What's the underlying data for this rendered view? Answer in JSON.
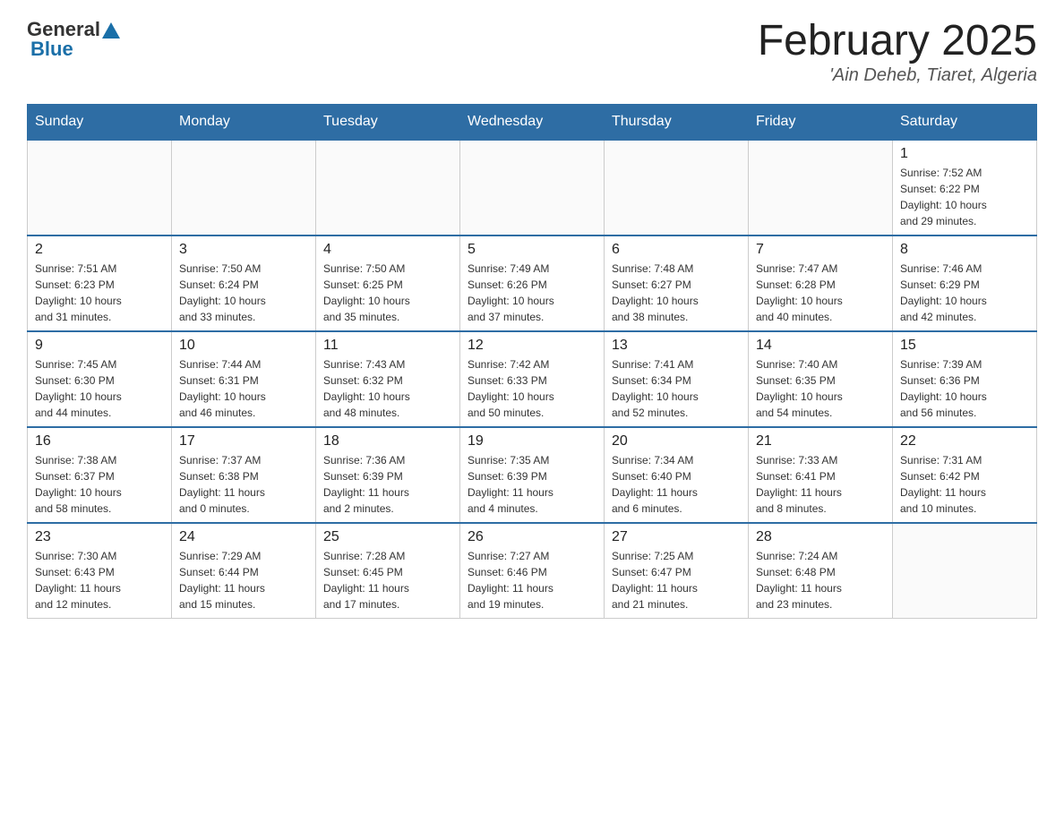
{
  "header": {
    "title": "February 2025",
    "subtitle": "'Ain Deheb, Tiaret, Algeria",
    "logo_general": "General",
    "logo_blue": "Blue"
  },
  "days_of_week": [
    "Sunday",
    "Monday",
    "Tuesday",
    "Wednesday",
    "Thursday",
    "Friday",
    "Saturday"
  ],
  "weeks": [
    {
      "days": [
        {
          "number": "",
          "info": "",
          "empty": true
        },
        {
          "number": "",
          "info": "",
          "empty": true
        },
        {
          "number": "",
          "info": "",
          "empty": true
        },
        {
          "number": "",
          "info": "",
          "empty": true
        },
        {
          "number": "",
          "info": "",
          "empty": true
        },
        {
          "number": "",
          "info": "",
          "empty": true
        },
        {
          "number": "1",
          "info": "Sunrise: 7:52 AM\nSunset: 6:22 PM\nDaylight: 10 hours\nand 29 minutes.",
          "empty": false
        }
      ]
    },
    {
      "days": [
        {
          "number": "2",
          "info": "Sunrise: 7:51 AM\nSunset: 6:23 PM\nDaylight: 10 hours\nand 31 minutes.",
          "empty": false
        },
        {
          "number": "3",
          "info": "Sunrise: 7:50 AM\nSunset: 6:24 PM\nDaylight: 10 hours\nand 33 minutes.",
          "empty": false
        },
        {
          "number": "4",
          "info": "Sunrise: 7:50 AM\nSunset: 6:25 PM\nDaylight: 10 hours\nand 35 minutes.",
          "empty": false
        },
        {
          "number": "5",
          "info": "Sunrise: 7:49 AM\nSunset: 6:26 PM\nDaylight: 10 hours\nand 37 minutes.",
          "empty": false
        },
        {
          "number": "6",
          "info": "Sunrise: 7:48 AM\nSunset: 6:27 PM\nDaylight: 10 hours\nand 38 minutes.",
          "empty": false
        },
        {
          "number": "7",
          "info": "Sunrise: 7:47 AM\nSunset: 6:28 PM\nDaylight: 10 hours\nand 40 minutes.",
          "empty": false
        },
        {
          "number": "8",
          "info": "Sunrise: 7:46 AM\nSunset: 6:29 PM\nDaylight: 10 hours\nand 42 minutes.",
          "empty": false
        }
      ]
    },
    {
      "days": [
        {
          "number": "9",
          "info": "Sunrise: 7:45 AM\nSunset: 6:30 PM\nDaylight: 10 hours\nand 44 minutes.",
          "empty": false
        },
        {
          "number": "10",
          "info": "Sunrise: 7:44 AM\nSunset: 6:31 PM\nDaylight: 10 hours\nand 46 minutes.",
          "empty": false
        },
        {
          "number": "11",
          "info": "Sunrise: 7:43 AM\nSunset: 6:32 PM\nDaylight: 10 hours\nand 48 minutes.",
          "empty": false
        },
        {
          "number": "12",
          "info": "Sunrise: 7:42 AM\nSunset: 6:33 PM\nDaylight: 10 hours\nand 50 minutes.",
          "empty": false
        },
        {
          "number": "13",
          "info": "Sunrise: 7:41 AM\nSunset: 6:34 PM\nDaylight: 10 hours\nand 52 minutes.",
          "empty": false
        },
        {
          "number": "14",
          "info": "Sunrise: 7:40 AM\nSunset: 6:35 PM\nDaylight: 10 hours\nand 54 minutes.",
          "empty": false
        },
        {
          "number": "15",
          "info": "Sunrise: 7:39 AM\nSunset: 6:36 PM\nDaylight: 10 hours\nand 56 minutes.",
          "empty": false
        }
      ]
    },
    {
      "days": [
        {
          "number": "16",
          "info": "Sunrise: 7:38 AM\nSunset: 6:37 PM\nDaylight: 10 hours\nand 58 minutes.",
          "empty": false
        },
        {
          "number": "17",
          "info": "Sunrise: 7:37 AM\nSunset: 6:38 PM\nDaylight: 11 hours\nand 0 minutes.",
          "empty": false
        },
        {
          "number": "18",
          "info": "Sunrise: 7:36 AM\nSunset: 6:39 PM\nDaylight: 11 hours\nand 2 minutes.",
          "empty": false
        },
        {
          "number": "19",
          "info": "Sunrise: 7:35 AM\nSunset: 6:39 PM\nDaylight: 11 hours\nand 4 minutes.",
          "empty": false
        },
        {
          "number": "20",
          "info": "Sunrise: 7:34 AM\nSunset: 6:40 PM\nDaylight: 11 hours\nand 6 minutes.",
          "empty": false
        },
        {
          "number": "21",
          "info": "Sunrise: 7:33 AM\nSunset: 6:41 PM\nDaylight: 11 hours\nand 8 minutes.",
          "empty": false
        },
        {
          "number": "22",
          "info": "Sunrise: 7:31 AM\nSunset: 6:42 PM\nDaylight: 11 hours\nand 10 minutes.",
          "empty": false
        }
      ]
    },
    {
      "days": [
        {
          "number": "23",
          "info": "Sunrise: 7:30 AM\nSunset: 6:43 PM\nDaylight: 11 hours\nand 12 minutes.",
          "empty": false
        },
        {
          "number": "24",
          "info": "Sunrise: 7:29 AM\nSunset: 6:44 PM\nDaylight: 11 hours\nand 15 minutes.",
          "empty": false
        },
        {
          "number": "25",
          "info": "Sunrise: 7:28 AM\nSunset: 6:45 PM\nDaylight: 11 hours\nand 17 minutes.",
          "empty": false
        },
        {
          "number": "26",
          "info": "Sunrise: 7:27 AM\nSunset: 6:46 PM\nDaylight: 11 hours\nand 19 minutes.",
          "empty": false
        },
        {
          "number": "27",
          "info": "Sunrise: 7:25 AM\nSunset: 6:47 PM\nDaylight: 11 hours\nand 21 minutes.",
          "empty": false
        },
        {
          "number": "28",
          "info": "Sunrise: 7:24 AM\nSunset: 6:48 PM\nDaylight: 11 hours\nand 23 minutes.",
          "empty": false
        },
        {
          "number": "",
          "info": "",
          "empty": true
        }
      ]
    }
  ]
}
